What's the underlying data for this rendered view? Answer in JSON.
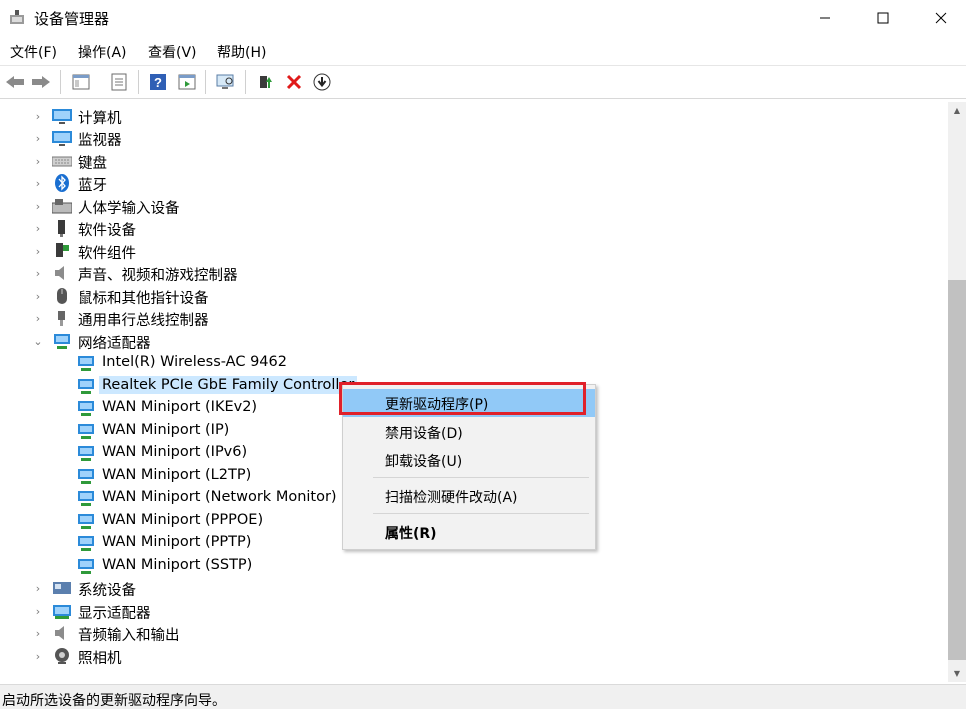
{
  "window": {
    "title": "设备管理器"
  },
  "menu": [
    {
      "label": "文件(F)"
    },
    {
      "label": "操作(A)"
    },
    {
      "label": "查看(V)"
    },
    {
      "label": "帮助(H)"
    }
  ],
  "toolbar": [
    "back-icon",
    "forward-icon",
    "show-hide-console-tree-icon",
    "properties-icon",
    "help-icon",
    "show-action-pane-icon",
    "scan-hardware-icon",
    "update-driver-icon",
    "uninstall-device-icon",
    "enable-device-icon"
  ],
  "tree": {
    "top": [
      {
        "label": "计算机",
        "icon": "computer-icon"
      },
      {
        "label": "监视器",
        "icon": "monitor-icon"
      },
      {
        "label": "键盘",
        "icon": "keyboard-icon"
      },
      {
        "label": "蓝牙",
        "icon": "bluetooth-icon"
      },
      {
        "label": "人体学输入设备",
        "icon": "hid-icon"
      },
      {
        "label": "软件设备",
        "icon": "software-device-icon"
      },
      {
        "label": "软件组件",
        "icon": "software-component-icon"
      },
      {
        "label": "声音、视频和游戏控制器",
        "icon": "speaker-icon"
      },
      {
        "label": "鼠标和其他指针设备",
        "icon": "mouse-icon"
      },
      {
        "label": "通用串行总线控制器",
        "icon": "usb-icon"
      },
      {
        "label": "网络适配器",
        "icon": "network-icon"
      }
    ],
    "network_children": [
      {
        "label": "Intel(R) Wireless-AC 9462"
      },
      {
        "label": "Realtek PCIe GbE Family Controller",
        "selected": true
      },
      {
        "label": "WAN Miniport (IKEv2)"
      },
      {
        "label": "WAN Miniport (IP)"
      },
      {
        "label": "WAN Miniport (IPv6)"
      },
      {
        "label": "WAN Miniport (L2TP)"
      },
      {
        "label": "WAN Miniport (Network Monitor)"
      },
      {
        "label": "WAN Miniport (PPPOE)"
      },
      {
        "label": "WAN Miniport (PPTP)"
      },
      {
        "label": "WAN Miniport (SSTP)"
      }
    ],
    "bottom": [
      {
        "label": "系统设备",
        "icon": "system-device-icon"
      },
      {
        "label": "显示适配器",
        "icon": "display-adapter-icon"
      },
      {
        "label": "音频输入和输出",
        "icon": "audio-io-icon"
      },
      {
        "label": "照相机",
        "icon": "camera-icon"
      }
    ]
  },
  "context_menu": {
    "update": "更新驱动程序(P)",
    "disable": "禁用设备(D)",
    "uninstall": "卸载设备(U)",
    "scan": "扫描检测硬件改动(A)",
    "properties": "属性(R)"
  },
  "status": {
    "text": "启动所选设备的更新驱动程序向导。"
  },
  "colors": {
    "selection": "#cce8ff",
    "menu_highlight": "#91c9f7",
    "annotation_box": "#e0212a"
  }
}
